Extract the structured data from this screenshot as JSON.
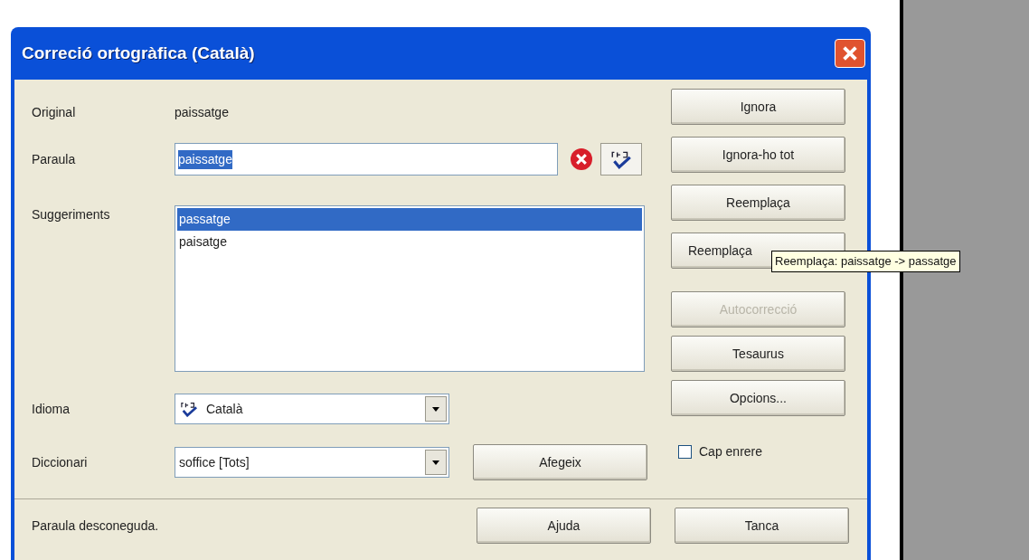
{
  "window": {
    "title": "Correció ortogràfica (Català)"
  },
  "original": {
    "label": "Original",
    "value": "paissatge"
  },
  "word": {
    "label": "Paraula",
    "value": "paissatge",
    "text_selected": true
  },
  "suggestions": {
    "label": "Suggeriments",
    "items": [
      {
        "text": "passatge",
        "selected": true
      },
      {
        "text": "paisatge",
        "selected": false
      }
    ]
  },
  "language": {
    "label": "Idioma",
    "value": "Català"
  },
  "dictionary": {
    "label": "Diccionari",
    "value": "soffice [Tots]"
  },
  "add_button": {
    "label": "Afegeix"
  },
  "side_buttons": [
    {
      "label": "Ignora",
      "disabled": false
    },
    {
      "label": "Ignora-ho tot",
      "disabled": false
    },
    {
      "label": "Reemplaça",
      "disabled": false
    },
    {
      "label": "Reemplaça",
      "disabled": false
    },
    {
      "label": "Autocorrecció",
      "disabled": true
    },
    {
      "label": "Tesaurus",
      "disabled": false
    },
    {
      "label": "Opcions...",
      "disabled": false
    }
  ],
  "backwards": {
    "label": "Cap enrere",
    "checked": false
  },
  "tooltip": "Reemplaça: paissatge -> passatge",
  "status_bar": {
    "text": "Paraula desconeguda.",
    "buttons": [
      "Ajuda",
      "Tanca"
    ]
  }
}
